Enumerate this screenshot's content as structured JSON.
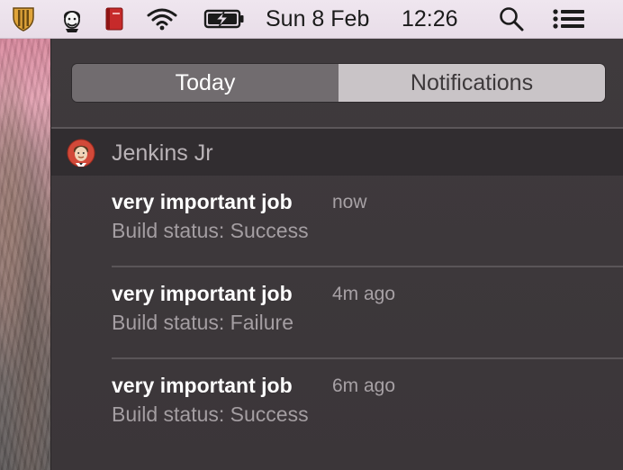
{
  "menubar": {
    "icons": [
      "shield-app-icon",
      "face-avatar-icon",
      "red-book-icon",
      "wifi-icon",
      "battery-charging-icon",
      "spotlight-search-icon",
      "notification-center-icon"
    ],
    "date": "Sun 8 Feb",
    "time": "12:26"
  },
  "tabs": {
    "today": "Today",
    "notifications": "Notifications",
    "selected": "Today"
  },
  "app": {
    "name": "Jenkins Jr",
    "icon": "jenkins-butler-icon"
  },
  "notifications": [
    {
      "title": "very important job",
      "time": "now",
      "body": "Build status: Success"
    },
    {
      "title": "very important job",
      "time": "4m ago",
      "body": "Build status: Failure"
    },
    {
      "title": "very important job",
      "time": "6m ago",
      "body": "Build status: Success"
    }
  ],
  "colors": {
    "menubar_bg": "#ebe1eb",
    "panel_bg": "#3d383b",
    "app_header_bg": "#312d30",
    "tab_selected_bg": "#716c6f",
    "tab_unselected_bg": "#c9c4c7"
  }
}
